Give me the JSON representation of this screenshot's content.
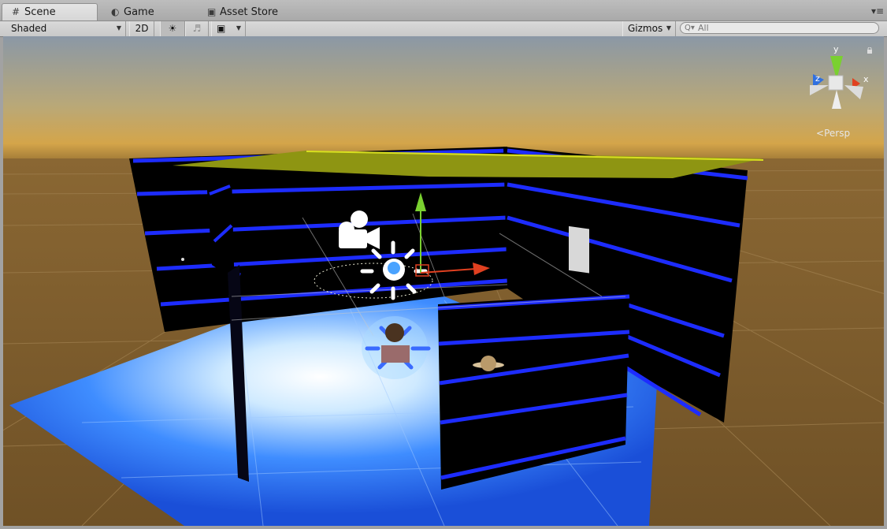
{
  "tabs": [
    {
      "label": "Scene",
      "icon": "grid-icon",
      "active": true
    },
    {
      "label": "Game",
      "icon": "pacman-icon",
      "active": false
    },
    {
      "label": "Asset Store",
      "icon": "bag-icon",
      "active": false
    }
  ],
  "toolbar": {
    "shading_mode": "Shaded",
    "mode_2d": "2D",
    "gizmos_label": "Gizmos",
    "search_placeholder": "All"
  },
  "scene_gizmo": {
    "axis_y": "y",
    "axis_x": "x",
    "axis_z": "z",
    "projection": "Persp"
  },
  "colors": {
    "sky_top": "#8c9aa8",
    "horizon": "#c9a350",
    "ground": "#7a5a2c",
    "wall": "#000000",
    "wall_stripe": "#1a2bff",
    "ceiling": "#9a9a10",
    "floor_light": "#4aa0ff",
    "axis_x": "#e04020",
    "axis_y": "#7ad030",
    "axis_z": "#3070e0"
  }
}
